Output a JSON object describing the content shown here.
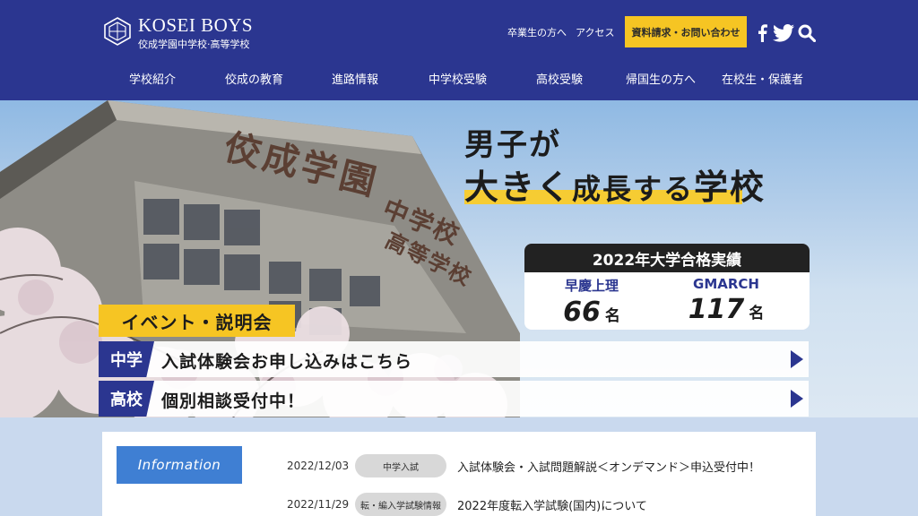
{
  "header": {
    "logo_name": "KOSEI BOYS",
    "logo_sub": "佼成学園中学校·高等学校",
    "links": {
      "alumni": "卒業生の方へ",
      "access": "アクセス"
    },
    "request_button": "資料請求・お問い合わせ",
    "icons": [
      "facebook-icon",
      "twitter-icon",
      "search-icon"
    ],
    "brand_color": "#2b3690",
    "accent_color": "#f6c523"
  },
  "nav": {
    "items": [
      {
        "label": "学校紹介"
      },
      {
        "label": "佼成の教育"
      },
      {
        "label": "進路情報"
      },
      {
        "label": "中学校受験"
      },
      {
        "label": "高校受験"
      },
      {
        "label": "帰国生の方へ"
      },
      {
        "label": "在校生・保護者"
      }
    ]
  },
  "hero": {
    "slogan_line1": "男子が",
    "slogan_big": "大きく",
    "slogan_mid": "成長する",
    "slogan_end": "学校",
    "building_sign_1": "佼成学園",
    "building_sign_2": "中学校",
    "building_sign_3": "高等学校",
    "results": {
      "title": "2022年大学合格実績",
      "items": [
        {
          "label": "早慶上理",
          "value": "66",
          "unit": "名"
        },
        {
          "label": "GMARCH",
          "value": "117",
          "unit": "名"
        }
      ]
    },
    "events": {
      "label": "イベント・説明会",
      "rows": [
        {
          "tag": "中学",
          "text": "入試体験会お申し込みはこちら"
        },
        {
          "tag": "高校",
          "text": "個別相談受付中！"
        }
      ]
    }
  },
  "info": {
    "button": "Information",
    "news": [
      {
        "date": "2022/12/03",
        "category": "中学入試",
        "title": "入試体験会・入試問題解説＜オンデマンド＞申込受付中！"
      },
      {
        "date": "2022/11/29",
        "category": "転・編入学試験情報",
        "title": "2022年度転入学試験(国内)について"
      }
    ]
  }
}
